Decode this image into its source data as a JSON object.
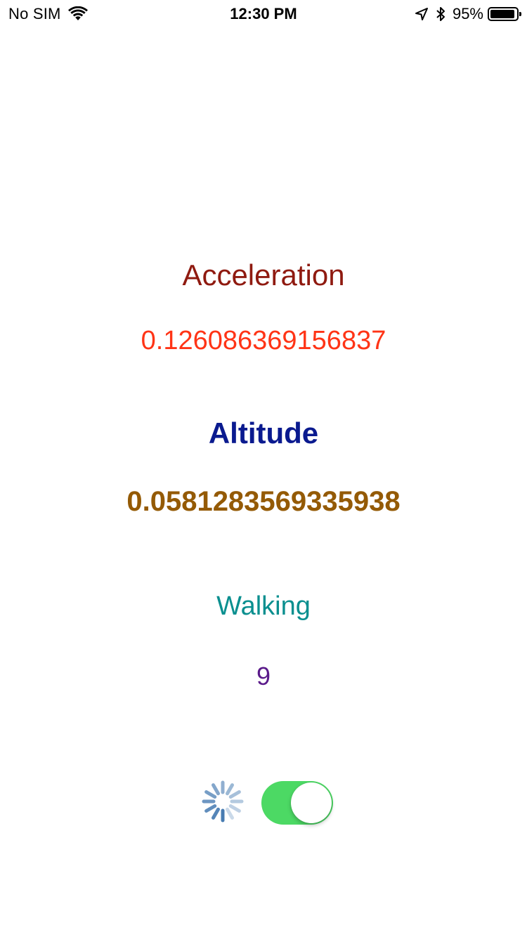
{
  "status_bar": {
    "carrier": "No SIM",
    "time": "12:30 PM",
    "battery_percent": "95%",
    "battery_level": 0.95,
    "icons": [
      "wifi-icon",
      "location-arrow-icon",
      "bluetooth-icon",
      "battery-icon"
    ]
  },
  "acceleration": {
    "title": "Acceleration",
    "value": "0.126086369156837"
  },
  "altitude": {
    "title": "Altitude",
    "value": "0.0581283569335938"
  },
  "walking": {
    "title": "Walking",
    "count": "9"
  },
  "controls": {
    "spinner_icon": "activity-spinner-icon",
    "toggle_on": true,
    "toggle_color": "#4cd964"
  },
  "colors": {
    "acceleration_title": "#8f1a10",
    "acceleration_value": "#ff3416",
    "altitude_title": "#0a1a8f",
    "altitude_value": "#945a05",
    "walking_title": "#0a8f8f",
    "walking_count": "#5a1a8a"
  }
}
